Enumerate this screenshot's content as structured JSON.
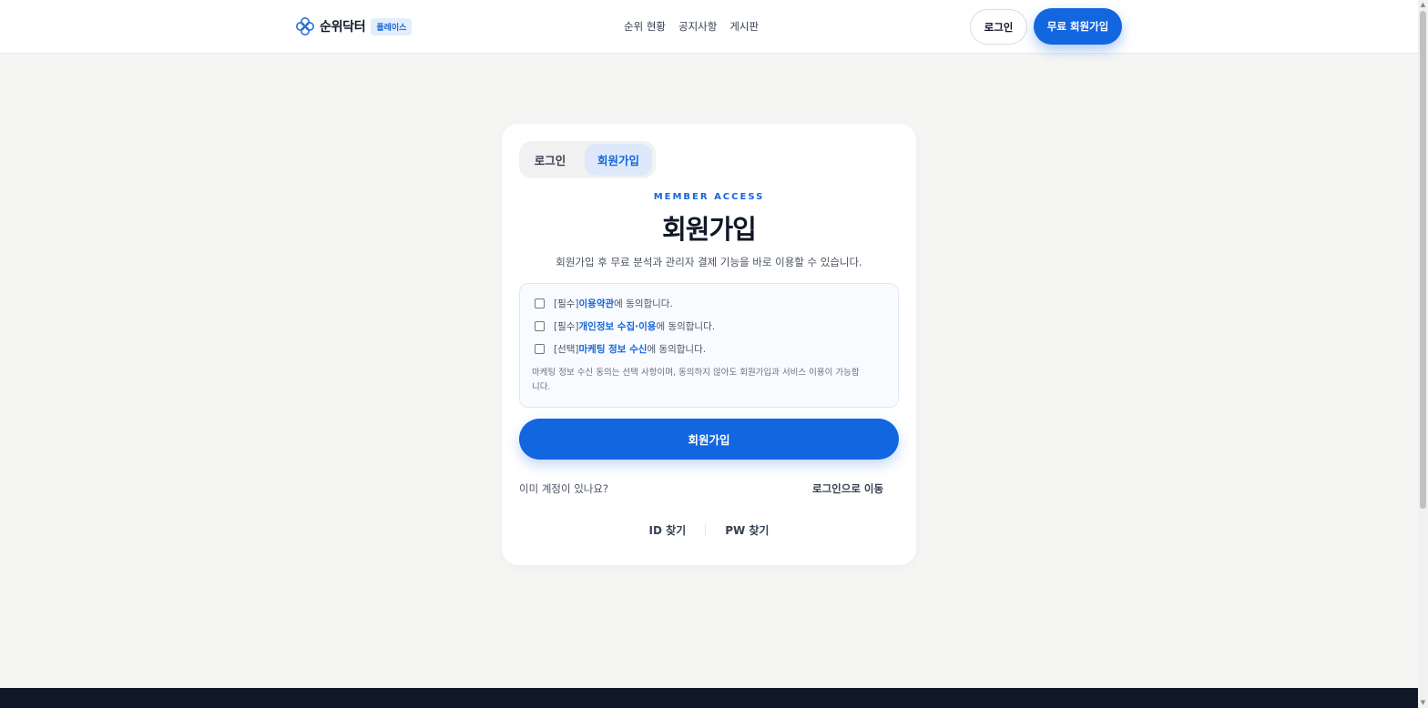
{
  "header": {
    "brand_name": "순위닥터",
    "brand_badge": "플레이스",
    "nav": [
      "순위 현황",
      "공지사항",
      "게시판"
    ],
    "login_label": "로그인",
    "signup_label": "무료 회원가입"
  },
  "card": {
    "tabs": {
      "login": "로그인",
      "signup": "회원가입"
    },
    "eyebrow": "MEMBER ACCESS",
    "title": "회원가입",
    "subtitle": "회원가입 후 무료 분석과 관리자 결제 기능을 바로 이용할 수 있습니다.",
    "agreements": [
      {
        "prefix": "[필수] ",
        "link": "이용약관",
        "suffix": "에 동의합니다.",
        "checked": false
      },
      {
        "prefix": "[필수] ",
        "link": "개인정보 수집·이용",
        "suffix": "에 동의합니다.",
        "checked": false
      },
      {
        "prefix": "[선택] ",
        "link": "마케팅 정보 수신",
        "suffix": "에 동의합니다.",
        "checked": false
      }
    ],
    "note": "마케팅 정보 수신 동의는 선택 사항이며, 동의하지 않아도 회원가입과 서비스 이용이 가능합니다.",
    "submit_label": "회원가입",
    "already_text": "이미 계정이 있나요?",
    "goto_login": "로그인으로 이동",
    "find_id": "ID 찾기",
    "find_pw": "PW 찾기"
  },
  "colors": {
    "accent": "#1266e0",
    "footer": "#111827",
    "page_bg": "#f5f5f3"
  },
  "icons": {
    "brand": "clover-logo-icon",
    "scroll_up": "arrow-up-icon",
    "scroll_down": "arrow-down-icon"
  }
}
